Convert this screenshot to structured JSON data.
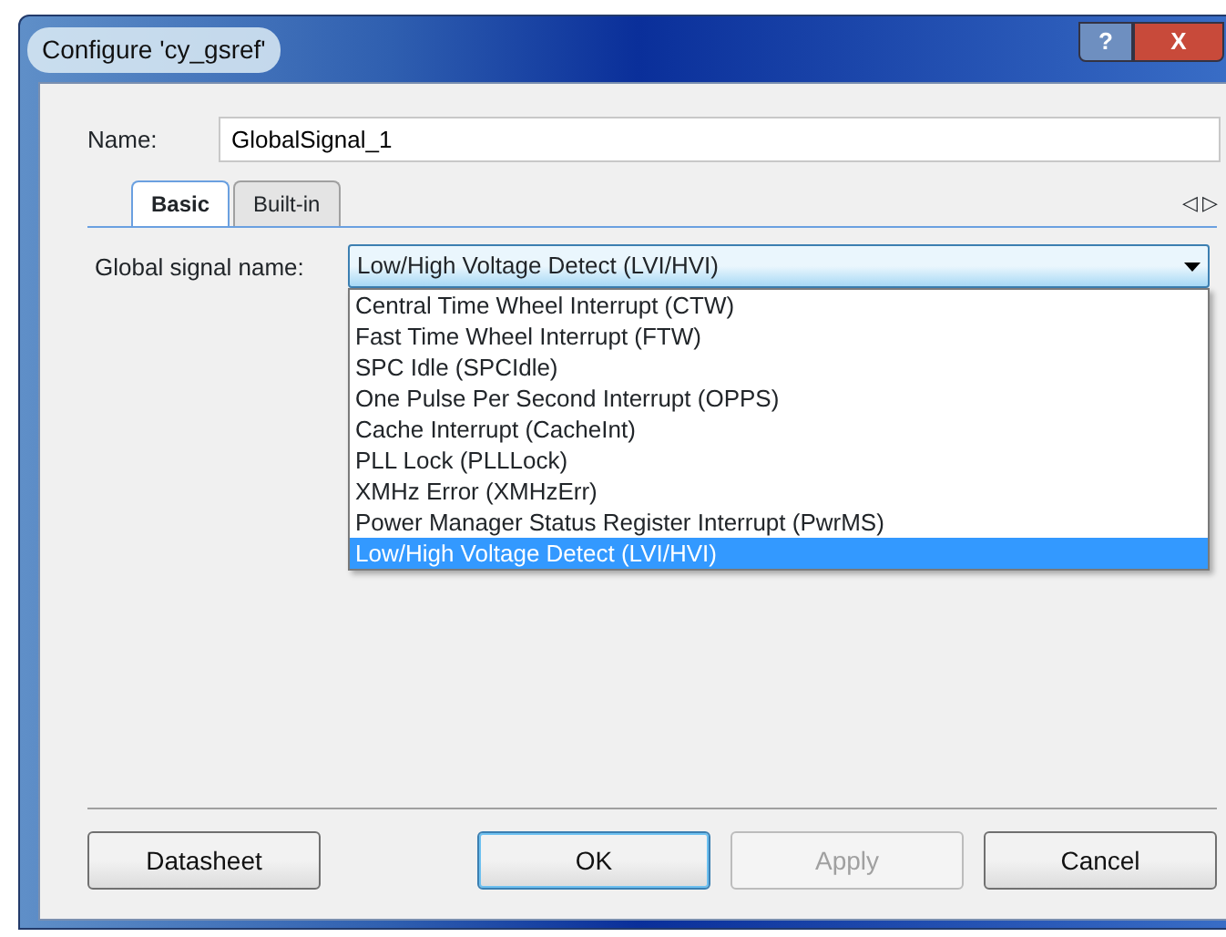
{
  "window": {
    "title": "Configure 'cy_gsref'",
    "buttons": [
      "?",
      "X"
    ]
  },
  "name_field": {
    "label": "Name:",
    "value": "GlobalSignal_1"
  },
  "tabs": [
    {
      "label": "Basic",
      "selected": true
    },
    {
      "label": "Built-in",
      "selected": false
    }
  ],
  "tab_scroll": [
    "◁",
    "▷"
  ],
  "signal": {
    "label": "Global signal name:",
    "value": "Low/High Voltage Detect (LVI/HVI)",
    "expanded": true,
    "options": [
      {
        "label": "Central Time Wheel Interrupt (CTW)",
        "selected": false
      },
      {
        "label": "Fast Time Wheel Interrupt (FTW)",
        "selected": false
      },
      {
        "label": "SPC Idle (SPCIdle)",
        "selected": false
      },
      {
        "label": "One Pulse Per Second Interrupt (OPPS)",
        "selected": false
      },
      {
        "label": "Cache Interrupt (CacheInt)",
        "selected": false
      },
      {
        "label": "PLL Lock (PLLLock)",
        "selected": false
      },
      {
        "label": "XMHz Error (XMHzErr)",
        "selected": false
      },
      {
        "label": "Power Manager Status Register Interrupt (PwrMS)",
        "selected": false
      },
      {
        "label": "Low/High Voltage Detect (LVI/HVI)",
        "selected": true
      }
    ]
  },
  "buttons": [
    {
      "label": "Datasheet",
      "disabled": false,
      "default": false
    },
    {
      "label": "OK",
      "disabled": false,
      "default": true
    },
    {
      "label": "Apply",
      "disabled": true,
      "default": false
    },
    {
      "label": "Cancel",
      "disabled": false,
      "default": false
    }
  ]
}
